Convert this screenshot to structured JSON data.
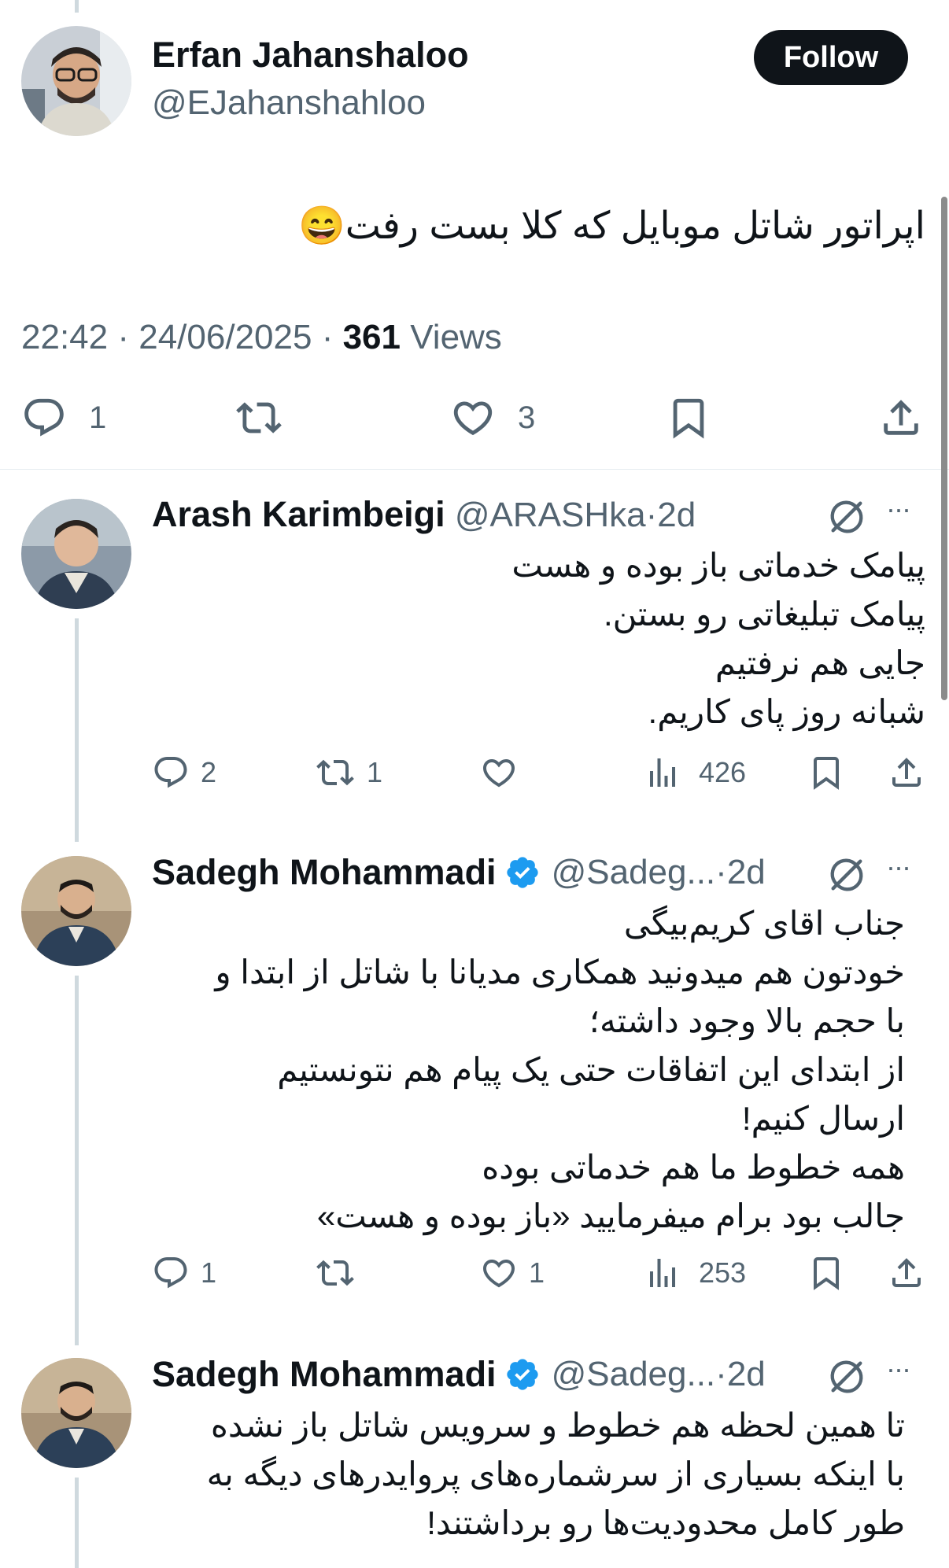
{
  "original_tweet": {
    "author_name": "Erfan Jahanshaloo",
    "author_handle": "@EJahanshahloo",
    "follow_label": "Follow",
    "text": "اپراتور شاتل موبایل که کلا بست رفت😄",
    "time": "22:42",
    "date": "24/06/2025",
    "views_count": "361",
    "views_label": "Views",
    "separator": "·",
    "reply_count": "1",
    "like_count": "3"
  },
  "replies": [
    {
      "author_name": "Arash Karimbeigi",
      "author_handle": "@ARASHka",
      "age": "2d",
      "separator": "·",
      "more": "···",
      "text": "پیامک خدماتی باز بوده و هست\nپیامک تبلیغاتی رو بستن.\nجایی هم نرفتیم\nشبانه روز پای کاریم.",
      "reply_count": "2",
      "repost_count": "1",
      "like_count": "",
      "view_count": "426"
    },
    {
      "author_name": "Sadegh Mohammadi",
      "author_handle": "@Sadeg...",
      "age": "2d",
      "separator": "·",
      "more": "···",
      "text": "جناب اقای کریم‌بیگی\nخودتون هم میدونید همکاری مدیانا با شاتل از ابتدا و\nبا حجم بالا وجود داشته؛\nاز ابتدای این اتفاقات حتی یک پیام هم نتونستیم\nارسال کنیم!\nهمه خطوط ما هم خدماتی بوده\nجالب بود برام میفرمایید «باز بوده و هست»",
      "reply_count": "1",
      "repost_count": "",
      "like_count": "1",
      "view_count": "253"
    },
    {
      "author_name": "Sadegh Mohammadi",
      "author_handle": "@Sadeg...",
      "age": "2d",
      "separator": "·",
      "more": "···",
      "text": "تا همین لحظه هم خطوط و سرویس شاتل باز نشده\nبا اینکه بسیاری از سرشماره‌های پروایدرهای دیگه به\nطور کامل محدودیت‌ها رو برداشتند!"
    }
  ],
  "colors": {
    "text_primary": "#0f1419",
    "text_secondary": "#536471",
    "verified": "#1d9bf0",
    "thread_line": "#cfd9de",
    "button_bg": "#0f1419"
  },
  "icons": {
    "reply": "reply-icon",
    "repost": "repost-icon",
    "like": "heart-icon",
    "bookmark": "bookmark-icon",
    "share": "share-icon",
    "views": "views-icon",
    "grok": "grok-icon",
    "more": "more-icon",
    "verified": "verified-badge-icon"
  }
}
